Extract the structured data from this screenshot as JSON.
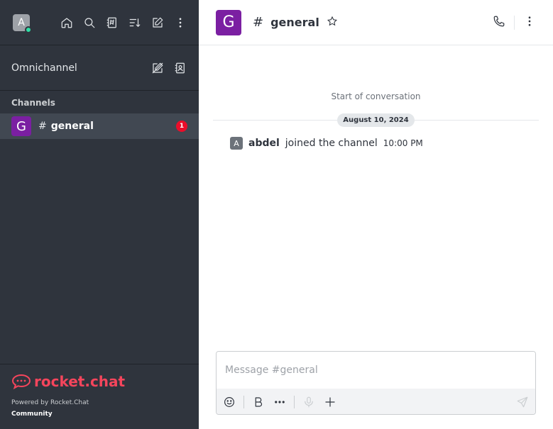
{
  "sidebar": {
    "user_initial": "A",
    "top_icons": [
      "home-icon",
      "search-icon",
      "directory-icon",
      "sort-icon",
      "compose-icon",
      "kebab-menu-icon"
    ],
    "omnichannel_label": "Omnichannel",
    "section_title": "Channels",
    "rooms": [
      {
        "initial": "G",
        "hash": "#",
        "name": "general",
        "unread": "1",
        "color": "#7b1fa2"
      }
    ],
    "footer": {
      "logo_text": "rocket.chat",
      "powered_by": "Powered by Rocket.Chat",
      "edition": "Community"
    }
  },
  "header": {
    "initial": "G",
    "hash": "#",
    "room_name": "general"
  },
  "conversation": {
    "start_text": "Start of conversation",
    "date": "August 10, 2024",
    "messages": [
      {
        "initial": "A",
        "user": "abdel",
        "text": "joined the channel",
        "time": "10:00 PM"
      }
    ]
  },
  "composer": {
    "placeholder": "Message #general"
  },
  "colors": {
    "sidebar_bg": "#2f343d",
    "accent": "#f5455c",
    "room_avatar": "#7b1fa2",
    "badge": "#ec0d2a",
    "online": "#2de0a5"
  }
}
